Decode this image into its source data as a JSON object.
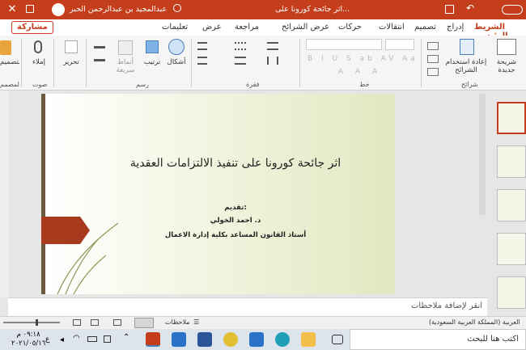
{
  "titlebar": {
    "doc_title": "اثر جائحة كورونا على...",
    "user_name": "عبدالمجيد بن عبدالرحمن الحبر"
  },
  "ribbon_tabs": {
    "share_label": "مشاركة",
    "tabs": [
      "الشريط الرئيسي",
      "إدراج",
      "تصميم",
      "انتقالات",
      "حركات",
      "عرض الشرائح",
      "مراجعة",
      "عرض",
      "تعليمات"
    ],
    "active_tab": "الشريط الرئيسي"
  },
  "ribbon": {
    "new_slide_label": "شريحة جديدة",
    "reuse_slides_label": "إعادة استخدام الشرائح",
    "slides_group": "شرائح",
    "font_group": "خط",
    "paragraph_group": "فقرة",
    "drawing_group": "رسم",
    "voice_group": "صوت",
    "shapes_label": "أشكال",
    "arrange_label": "ترتيب",
    "quick_styles_label": "أنماط سريعة",
    "editing_label": "تحرير",
    "dictate_label": "إملاء",
    "designer_label": "أفكار التصميم",
    "designer_group": "المصمم"
  },
  "slide": {
    "title": "اثر جائحة كورونا على تنفيذ الالتزامات العقدية",
    "presenter_heading": "تقديم:",
    "presenter_name": "د. احمد الخولي",
    "presenter_role": "أستاذ القانون المساعد بكلية إدارة الاعمال"
  },
  "notes": {
    "placeholder": "انقر لإضافة ملاحظات"
  },
  "statusbar": {
    "language": "العربية (المملكة العربية السعودية)",
    "notes_button": "ملاحظات"
  },
  "taskbar": {
    "search_placeholder": "اكتب هنا للبحث",
    "time": "٠٩:١٨ م",
    "date": "٢٠٢١/٠٥/١٦",
    "lang_indicator": "ع"
  },
  "colors": {
    "accent": "#c43e1c",
    "slide_arrow": "#a83a1e",
    "slide_bar": "#6b5a3e"
  }
}
